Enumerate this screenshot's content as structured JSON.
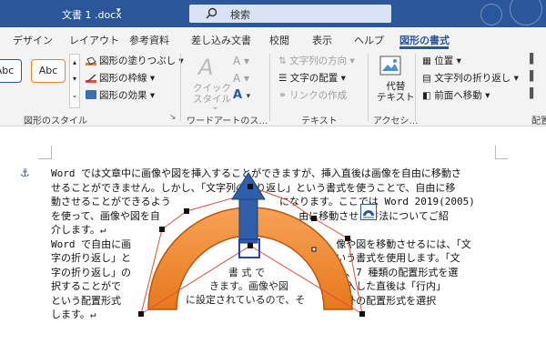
{
  "titlebar": {
    "doc_title": "文書 1 .docx",
    "caret": "▾",
    "search_placeholder": "検索"
  },
  "tabs": [
    {
      "label": "デザイン"
    },
    {
      "label": "レイアウト"
    },
    {
      "label": "参考資料"
    },
    {
      "label": "差し込み文書"
    },
    {
      "label": "校閲"
    },
    {
      "label": "表示"
    },
    {
      "label": "ヘルプ"
    },
    {
      "label": "図形の書式",
      "active": true
    }
  ],
  "ribbon": {
    "styles": {
      "box1": "Abc",
      "box2": "Abc",
      "group_label": "図形のスタイル"
    },
    "shape": {
      "fill": "図形の塗りつぶし",
      "outline": "図形の枠線",
      "effects": "図形の効果"
    },
    "wordart": {
      "quick_style": "クイック\nスタイル",
      "quick_caret": "⌄",
      "group_label": "ワードアートのス…"
    },
    "text": {
      "direction": "文字列の方向",
      "align": "文字の配置",
      "link": "リンクの作成",
      "group_label": "テキスト"
    },
    "accessibility": {
      "alt_text": "代替\nテキスト",
      "group_label": "アクセシ…"
    },
    "arrange": {
      "position": "位置",
      "wrap": "文字列の折り返し",
      "bring_forward": "前面へ移動",
      "group_label": "配置"
    },
    "colors": {
      "accent": "#2b579a",
      "shape_fill": "#f07f22",
      "shape_outline": "#e2503a"
    }
  },
  "document": {
    "lines": [
      "Word では文章中に画像や図を挿入することができますが、挿入直後は画像を自由に移動さ",
      "せることができません。しかし、「文字列の折り返し」という書式を使うことで、自由に移",
      "動させることができるよう                  になります。ここでは Word 2019(2005)",
      "を使って、画像や図を自                       由に移動させる方法についてご紹",
      "介します。↵",
      "Word で自由に画                                  像や図を移動させるには、「文",
      "字の折り返し」と                                  いう書式を使用します。「文",
      "字の折り返し」の                                  は、7 種類の配置形式を選",
      "択することがで                                  を挿入した直後は「行内」",
      "という配置形式                                  れ以外の配置形式を選択",
      "します。↵"
    ],
    "shape_text": [
      "書 式 で",
      "きます。画像や図",
      "に設定されているので、そ"
    ]
  },
  "icons": {
    "search": "search-icon",
    "anchor": "anchor-icon",
    "layout_options": "layout-options-icon",
    "rotate": "rotate-handle-icon",
    "alt_text": "alt-text-icon"
  }
}
